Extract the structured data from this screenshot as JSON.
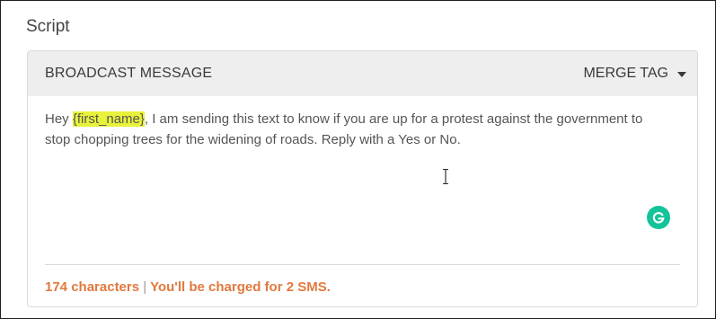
{
  "section": {
    "title": "Script"
  },
  "header": {
    "title": "BROADCAST MESSAGE",
    "merge_tag_label": "MERGE TAG"
  },
  "message": {
    "before": "Hey ",
    "merge_field": "{first_name}",
    "after": ", I am sending this text to know if you are up for a protest against the government to stop chopping trees for the widening of roads. Reply with a Yes or No."
  },
  "footer": {
    "character_count": "174 characters",
    "separator": "|",
    "charge_text": "You'll be charged for 2 SMS."
  },
  "icons": {
    "dropdown": "chevron-down-icon",
    "text_cursor": "text-cursor-icon",
    "grammarly": "grammarly-icon"
  },
  "colors": {
    "merge_field_highlight": "#e8f23a",
    "footer_accent": "#e0793e",
    "grammarly": "#15c39a",
    "header_background": "#eeeeee"
  }
}
